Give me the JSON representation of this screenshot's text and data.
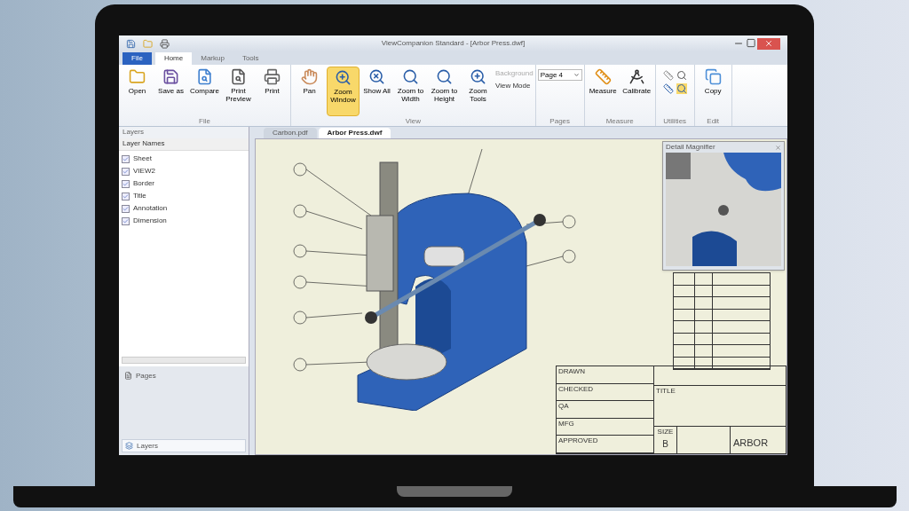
{
  "window": {
    "title": "ViewCompanion Standard - [Arbor Press.dwf]"
  },
  "ribbon_tabs": [
    {
      "label": "File",
      "selected": false,
      "kind": "file"
    },
    {
      "label": "Home",
      "selected": true,
      "kind": "tab"
    },
    {
      "label": "Markup",
      "selected": false,
      "kind": "tab"
    },
    {
      "label": "Tools",
      "selected": false,
      "kind": "tab"
    }
  ],
  "ribbon_groups": [
    {
      "label": "File",
      "buttons": [
        {
          "label": "Open",
          "selected": false
        },
        {
          "label": "Save as",
          "selected": false
        },
        {
          "label": "Compare",
          "selected": false
        },
        {
          "label": "Print Preview",
          "selected": false
        },
        {
          "label": "Print",
          "selected": false
        }
      ]
    },
    {
      "label": "View",
      "buttons": [
        {
          "label": "Pan",
          "selected": false
        },
        {
          "label": "Zoom Window",
          "selected": true
        },
        {
          "label": "Show All",
          "selected": false
        },
        {
          "label": "Zoom to Width",
          "selected": false
        },
        {
          "label": "Zoom to Height",
          "selected": false
        },
        {
          "label": "Zoom Tools",
          "selected": false
        }
      ],
      "small": [
        {
          "label": "Background",
          "disabled": true
        },
        {
          "label": "View Mode",
          "disabled": false
        }
      ]
    },
    {
      "label": "Pages",
      "dropdown": "Page 4"
    },
    {
      "label": "Measure",
      "buttons": [
        {
          "label": "Measure",
          "selected": false
        },
        {
          "label": "Calibrate",
          "selected": false
        }
      ]
    },
    {
      "label": "Utilities"
    },
    {
      "label": "Edit",
      "buttons": [
        {
          "label": "Copy",
          "selected": false
        }
      ]
    }
  ],
  "layers_panel": {
    "title": "Layers",
    "column": "Layer Names",
    "items": [
      {
        "label": "Sheet",
        "checked": true
      },
      {
        "label": "VIEW2",
        "checked": true
      },
      {
        "label": "Border",
        "checked": true
      },
      {
        "label": "Title",
        "checked": true
      },
      {
        "label": "Annotation",
        "checked": true
      },
      {
        "label": "Dimension",
        "checked": true
      }
    ]
  },
  "panel_nav": [
    {
      "label": "Pages",
      "selected": false
    },
    {
      "label": "Layers",
      "selected": true
    }
  ],
  "document_tabs": [
    {
      "label": "Carbon.pdf",
      "selected": false
    },
    {
      "label": "Arbor Press.dwf",
      "selected": true
    }
  ],
  "magnifier": {
    "title": "Detail Magnifier"
  },
  "title_block": {
    "rows": [
      "DRAWN",
      "CHECKED",
      "QA",
      "MFG",
      "APPROVED"
    ],
    "title_label": "TITLE",
    "size_label": "SIZE",
    "size": "B",
    "title": "ARBOR"
  }
}
